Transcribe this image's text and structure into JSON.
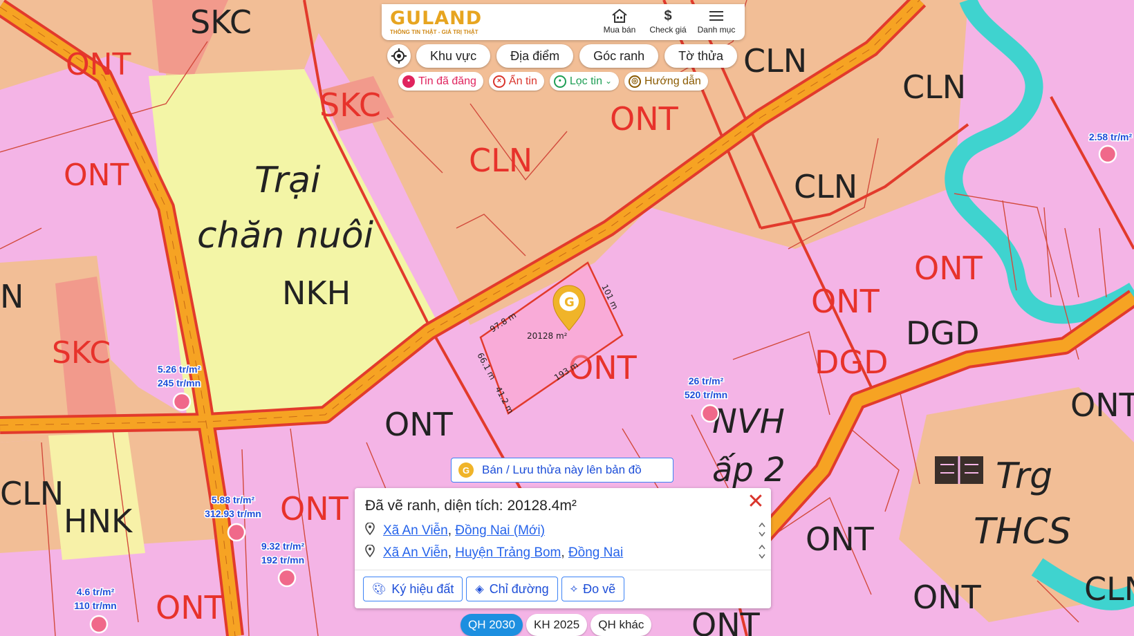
{
  "header": {
    "logo_text": "GULAND",
    "logo_tagline": "THÔNG TIN THẬT - GIÁ TRỊ THẬT",
    "nav": [
      {
        "label": "Mua bán",
        "icon": "house-icon"
      },
      {
        "label": "Check giá",
        "icon": "dollar-icon"
      },
      {
        "label": "Danh mục",
        "icon": "menu-icon"
      }
    ]
  },
  "search_pills": [
    "Khu vực",
    "Địa điểm",
    "Góc ranh",
    "Tờ thửa"
  ],
  "filter_chips": [
    {
      "label": "Tin đã đăng",
      "icon": "posted-icon",
      "color": "#e0245e"
    },
    {
      "label": "Ẩn tin",
      "icon": "hide-icon",
      "color": "#d9342b"
    },
    {
      "label": "Lọc tin",
      "icon": "filter-pin-icon",
      "color": "#1e9e55"
    },
    {
      "label": "Hướng dẫn",
      "icon": "guide-icon",
      "color": "#8a5a00"
    }
  ],
  "map": {
    "zones": [
      {
        "text": "SKC"
      },
      {
        "text": "ONT"
      },
      {
        "text": "ONT"
      },
      {
        "text": "SKC"
      },
      {
        "text": "CLN"
      },
      {
        "text": "ONT"
      },
      {
        "text": "CLN"
      },
      {
        "text": "CLN"
      },
      {
        "text": "CLN"
      },
      {
        "text": "Trại"
      },
      {
        "text": "chăn nuôi"
      },
      {
        "text": "NKH"
      },
      {
        "text": "N"
      },
      {
        "text": "SKC"
      },
      {
        "text": "ONT"
      },
      {
        "text": "ONT"
      },
      {
        "text": "DGD"
      },
      {
        "text": "DGD"
      },
      {
        "text": "ONT"
      },
      {
        "text": "ONT"
      },
      {
        "text": "NVH"
      },
      {
        "text": "ấp 2"
      },
      {
        "text": "ONT"
      },
      {
        "text": "CLN"
      },
      {
        "text": "HNK"
      },
      {
        "text": "ONT"
      },
      {
        "text": "ONT"
      },
      {
        "text": "Trg"
      },
      {
        "text": "THCS"
      },
      {
        "text": "ONT"
      },
      {
        "text": "ONT"
      },
      {
        "text": "CLN"
      },
      {
        "text": "ONT"
      }
    ],
    "parcel": {
      "area_label": "20128 m²",
      "edges": [
        "97.8 m",
        "101 m",
        "193 m",
        "66.1 m",
        "41.2 m"
      ]
    },
    "price_markers": [
      {
        "line1": "2.58 tr/m²",
        "line2": ""
      },
      {
        "line1": "5.26 tr/m²",
        "line2": "245 tr/mn"
      },
      {
        "line1": "26 tr/m²",
        "line2": "520 tr/mn"
      },
      {
        "line1": "5.88 tr/m²",
        "line2": "312.93 tr/mn"
      },
      {
        "line1": "9.32 tr/m²",
        "line2": "192 tr/mn"
      },
      {
        "line1": "4.6 tr/m²",
        "line2": "110 tr/mn"
      }
    ]
  },
  "save_button": "Bán / Lưu thửa này lên bản đồ",
  "panel": {
    "title": "Đã vẽ ranh, diện tích: 20128.4m²",
    "address1": {
      "commune": "Xã An Viễn",
      "province": "Đồng Nai (Mới)"
    },
    "address2": {
      "commune": "Xã An Viễn",
      "district": "Huyện Trảng Bom",
      "province": "Đồng Nai"
    },
    "buttons": [
      {
        "label": "Ký hiệu đất",
        "icon": "palette-icon"
      },
      {
        "label": "Chỉ đường",
        "icon": "directions-icon"
      },
      {
        "label": "Đo vẽ",
        "icon": "measure-icon"
      }
    ]
  },
  "bottom_tabs": [
    {
      "label": "QH 2030",
      "active": true
    },
    {
      "label": "KH 2025",
      "active": false
    },
    {
      "label": "QH khác",
      "active": false
    }
  ],
  "colors": {
    "residential": "#f4b4e6",
    "perennial": "#f2be96",
    "livestock": "#f3f5a6",
    "road": "#f6a323",
    "boundary": "#e23a2c",
    "river": "#3fd3cf",
    "zone_text_red": "#e7322b",
    "link_blue": "#2563eb",
    "accent_gold": "#f0b429"
  }
}
